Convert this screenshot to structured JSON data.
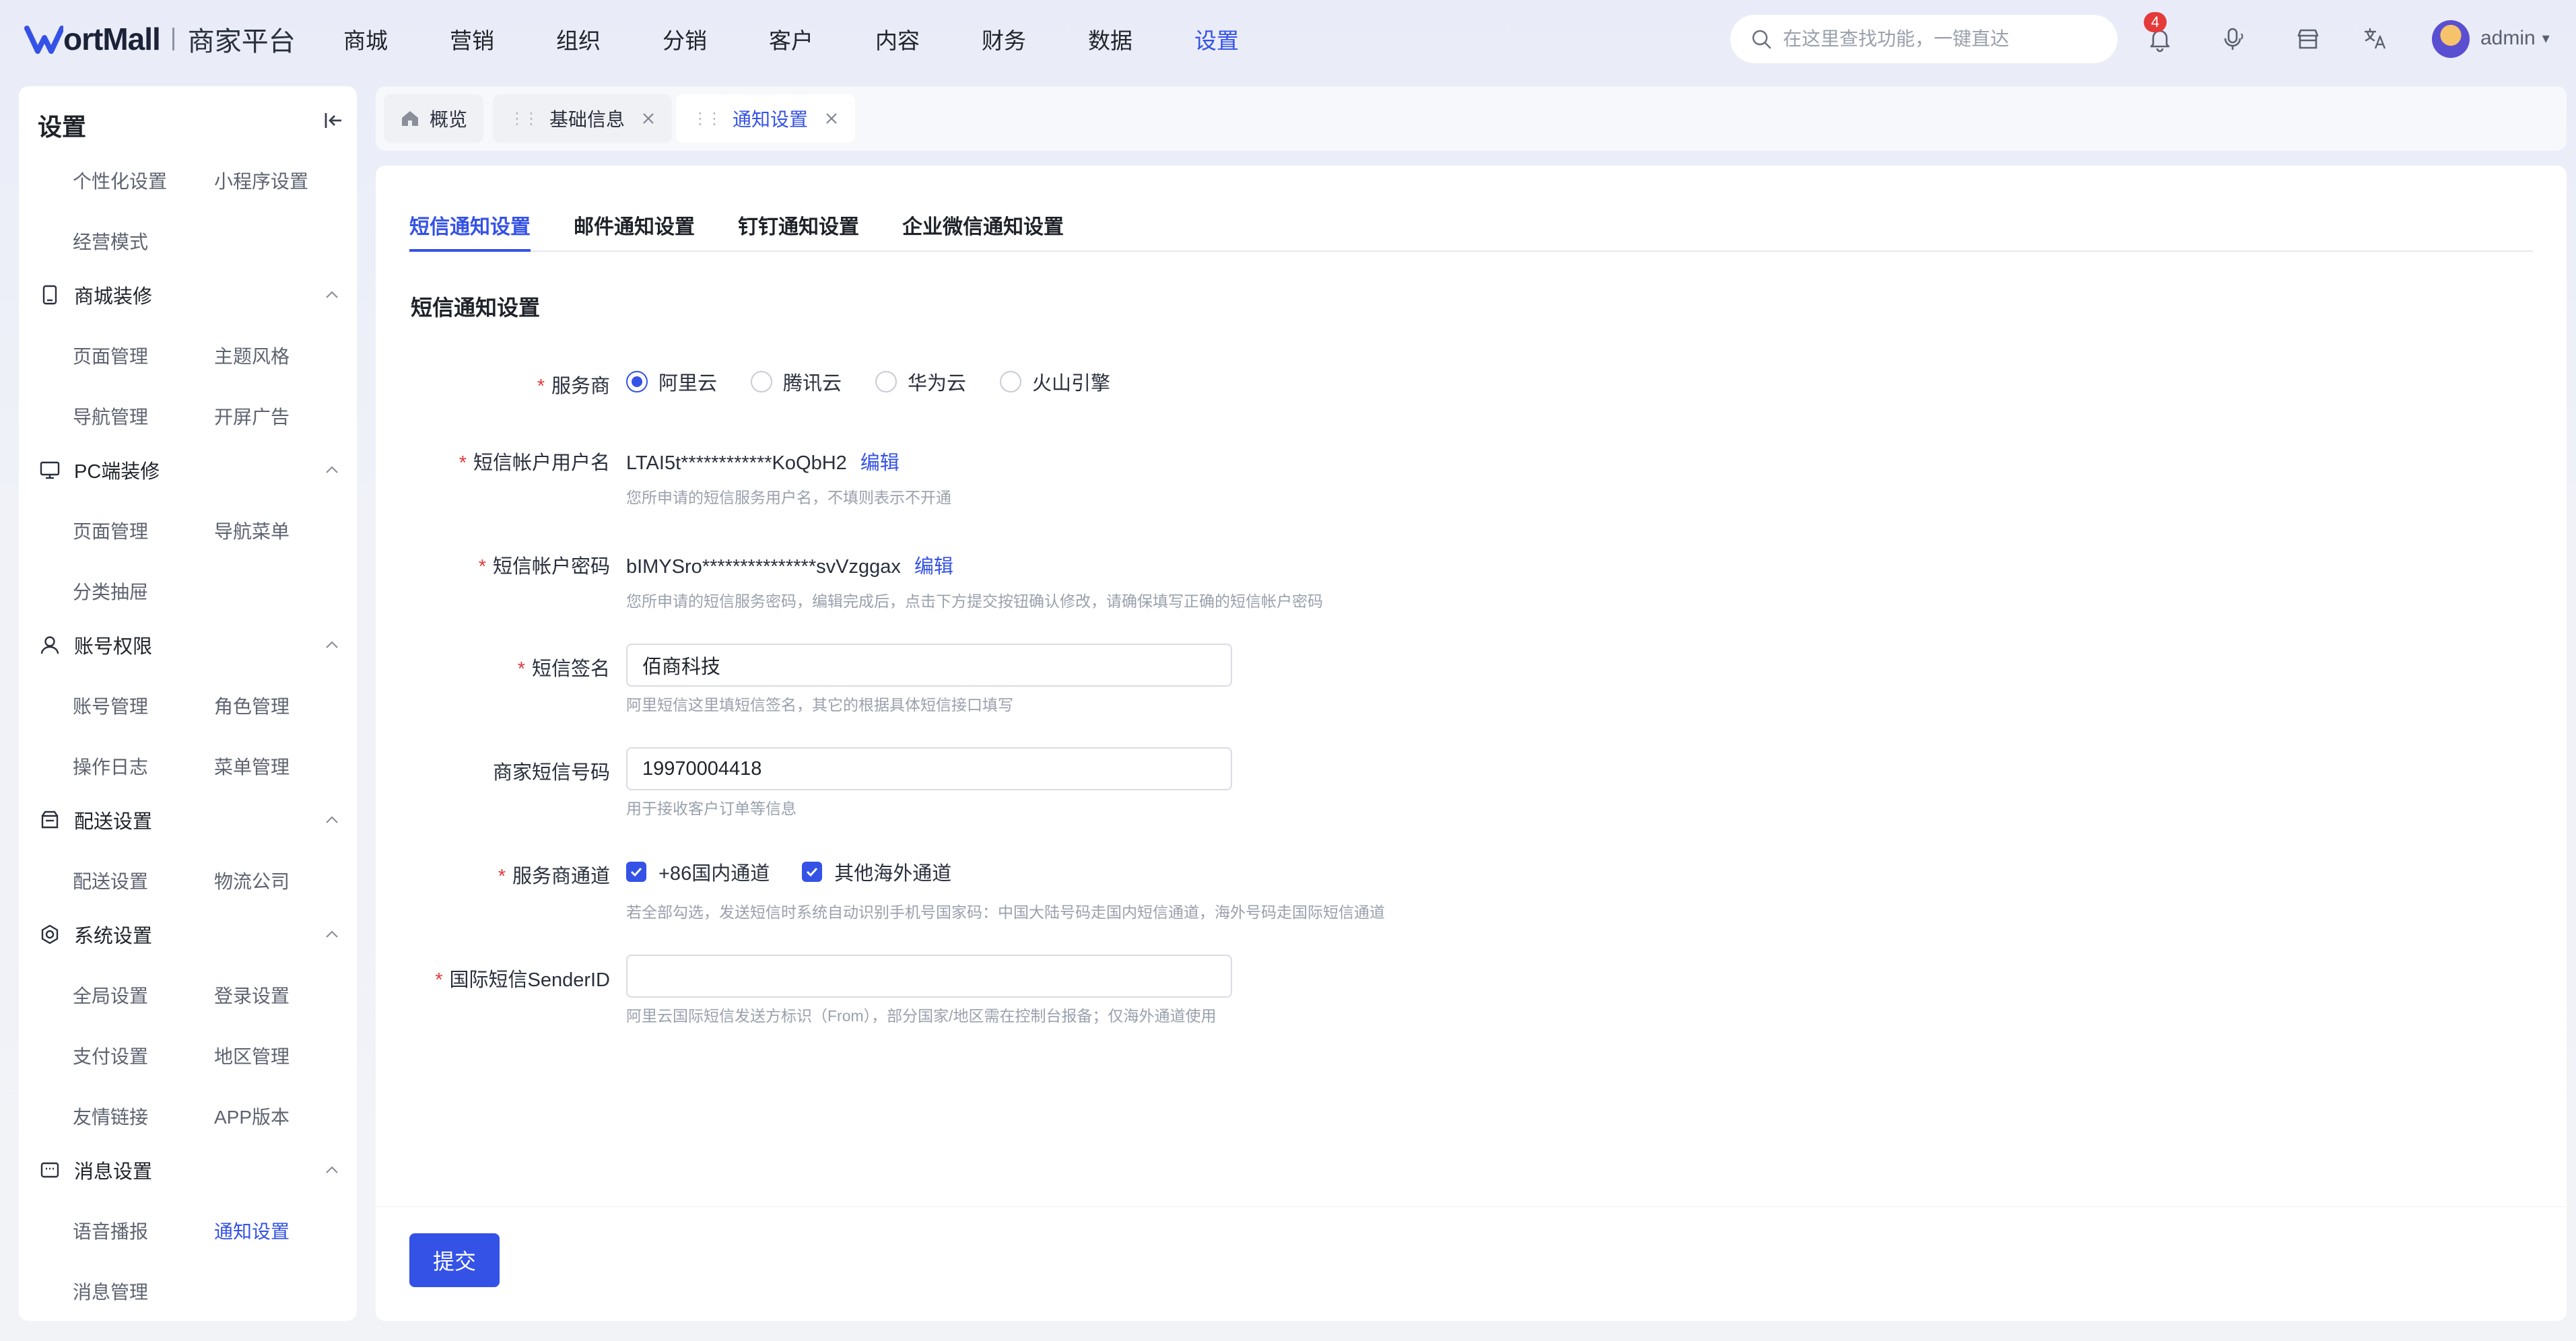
{
  "header": {
    "logo_text": "ortMall",
    "logo_sub": "商家平台",
    "nav": [
      "商城",
      "营销",
      "组织",
      "分销",
      "客户",
      "内容",
      "财务",
      "数据",
      "设置"
    ],
    "active_nav": "设置",
    "search_placeholder": "在这里查找功能，一键直达",
    "notification_count": "4",
    "user": "admin",
    "icons": [
      "bell-icon",
      "microphone-icon",
      "store-icon",
      "translate-icon"
    ]
  },
  "sidebar": {
    "title": "设置",
    "top_items": [
      "个性化设置",
      "小程序设置",
      "经营模式"
    ],
    "groups": [
      {
        "title": "商城装修",
        "icon": "store-icon",
        "items": [
          "页面管理",
          "主题风格",
          "导航管理",
          "开屏广告"
        ]
      },
      {
        "title": "PC端装修",
        "icon": "monitor-icon",
        "items": [
          "页面管理",
          "导航菜单",
          "分类抽屉"
        ]
      },
      {
        "title": "账号权限",
        "icon": "user-icon",
        "items": [
          "账号管理",
          "角色管理",
          "操作日志",
          "菜单管理"
        ]
      },
      {
        "title": "配送设置",
        "icon": "delivery-icon",
        "items": [
          "配送设置",
          "物流公司"
        ]
      },
      {
        "title": "系统设置",
        "icon": "gear-icon",
        "items": [
          "全局设置",
          "登录设置",
          "支付设置",
          "地区管理",
          "友情链接",
          "APP版本"
        ]
      },
      {
        "title": "消息设置",
        "icon": "message-icon",
        "items": [
          "语音播报",
          "通知设置",
          "消息管理"
        ]
      }
    ],
    "active_item": "通知设置"
  },
  "page_tabs": [
    {
      "label": "概览",
      "icon": "home-icon"
    },
    {
      "label": "基础信息"
    },
    {
      "label": "通知设置",
      "active": true
    }
  ],
  "sub_tabs": [
    "短信通知设置",
    "邮件通知设置",
    "钉钉通知设置",
    "企业微信通知设置"
  ],
  "form": {
    "section_title": "短信通知设置",
    "provider": {
      "label": "服务商",
      "options": [
        "阿里云",
        "腾讯云",
        "华为云",
        "火山引擎"
      ],
      "selected": "阿里云"
    },
    "username": {
      "label": "短信帐户用户名",
      "value": "LTAI5t************KoQbH2",
      "edit": "编辑",
      "hint": "您所申请的短信服务用户名，不填则表示不开通"
    },
    "password": {
      "label": "短信帐户密码",
      "value": "bIMYSro***************svVzggax",
      "edit": "编辑",
      "hint": "您所申请的短信服务密码，编辑完成后，点击下方提交按钮确认修改，请确保填写正确的短信帐户密码"
    },
    "signature": {
      "label": "短信签名",
      "value": "佰商科技",
      "hint": "阿里短信这里填短信签名，其它的根据具体短信接口填写"
    },
    "merchant_phone": {
      "label": "商家短信号码",
      "value": "19970004418",
      "hint": "用于接收客户订单等信息"
    },
    "channels": {
      "label": "服务商通道",
      "options": [
        "+86国内通道",
        "其他海外通道"
      ],
      "hint": "若全部勾选，发送短信时系统自动识别手机号国家码：中国大陆号码走国内短信通道，海外号码走国际短信通道"
    },
    "sender_id": {
      "label": "国际短信SenderID",
      "value": "",
      "hint": "阿里云国际短信发送方标识（From），部分国家/地区需在控制台报备；仅海外通道使用"
    },
    "submit": "提交"
  },
  "colors": {
    "accent": "#3452e6",
    "required": "#e43a3a",
    "badge": "#e43a3a"
  }
}
